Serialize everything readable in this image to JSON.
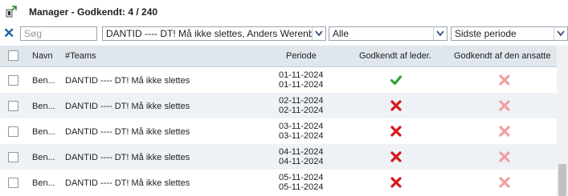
{
  "window": {
    "title": "Manager - Godkendt: 4 / 240"
  },
  "filters": {
    "search_placeholder": "Søg",
    "team_select": "DANTID ---- DT! Må ikke slettes, Anders  Werenberg",
    "status_select": "Alle",
    "period_select": "Sidste periode"
  },
  "table": {
    "columns": {
      "name": "Navn",
      "teams": "#Teams",
      "period": "Periode",
      "manager_approved": "Godkendt af leder.",
      "employee_approved": "Godkendt af den ansatte"
    },
    "rows": [
      {
        "name": "Ben...",
        "team": "DANTID ---- DT! Må ikke slettes",
        "from": "01-11-2024",
        "to": "01-11-2024",
        "manager_approved": true,
        "employee_approved": false
      },
      {
        "name": "Ben...",
        "team": "DANTID ---- DT! Må ikke slettes",
        "from": "02-11-2024",
        "to": "02-11-2024",
        "manager_approved": false,
        "employee_approved": false
      },
      {
        "name": "Ben...",
        "team": "DANTID ---- DT! Må ikke slettes",
        "from": "03-11-2024",
        "to": "03-11-2024",
        "manager_approved": false,
        "employee_approved": false
      },
      {
        "name": "Ben...",
        "team": "DANTID ---- DT! Må ikke slettes",
        "from": "04-11-2024",
        "to": "04-11-2024",
        "manager_approved": false,
        "employee_approved": false
      },
      {
        "name": "Ben...",
        "team": "DANTID ---- DT! Må ikke slettes",
        "from": "05-11-2024",
        "to": "05-11-2024",
        "manager_approved": false,
        "employee_approved": false
      }
    ]
  },
  "colors": {
    "approved_check": "#2e9e2e",
    "manager_cross": "#d81818",
    "employee_cross": "#f0a0a0",
    "accent": "#1f5fa8"
  }
}
